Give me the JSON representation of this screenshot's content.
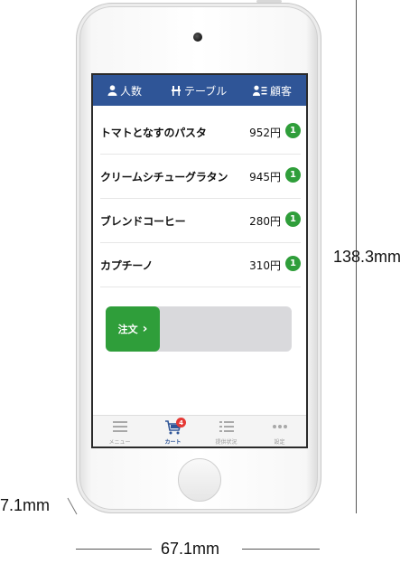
{
  "header": {
    "people_label": "人数",
    "table_label": "テーブル",
    "customer_label": "顧客"
  },
  "cart_items": [
    {
      "name": "トマトとなすのパスタ",
      "price": "952円",
      "qty": "1"
    },
    {
      "name": "クリームシチューグラタン",
      "price": "945円",
      "qty": "1"
    },
    {
      "name": "ブレンドコーヒー",
      "price": "280円",
      "qty": "1"
    },
    {
      "name": "カプチーノ",
      "price": "310円",
      "qty": "1"
    }
  ],
  "order_slider": {
    "label": "注文",
    "arrow": "›"
  },
  "tabbar": {
    "tabs": [
      {
        "label": "メニュー",
        "icon": "menu-list-icon"
      },
      {
        "label": "カート",
        "icon": "cart-icon",
        "badge": "4",
        "active": true
      },
      {
        "label": "提供状況",
        "icon": "serving-status-icon"
      },
      {
        "label": "設定",
        "icon": "more-dots-icon"
      }
    ]
  },
  "dimensions": {
    "height": "138.3mm",
    "width": "67.1mm",
    "depth": "7.1mm"
  },
  "colors": {
    "header_blue": "#2f5597",
    "accent_green": "#2f9e3a",
    "badge_red": "#e53935"
  }
}
